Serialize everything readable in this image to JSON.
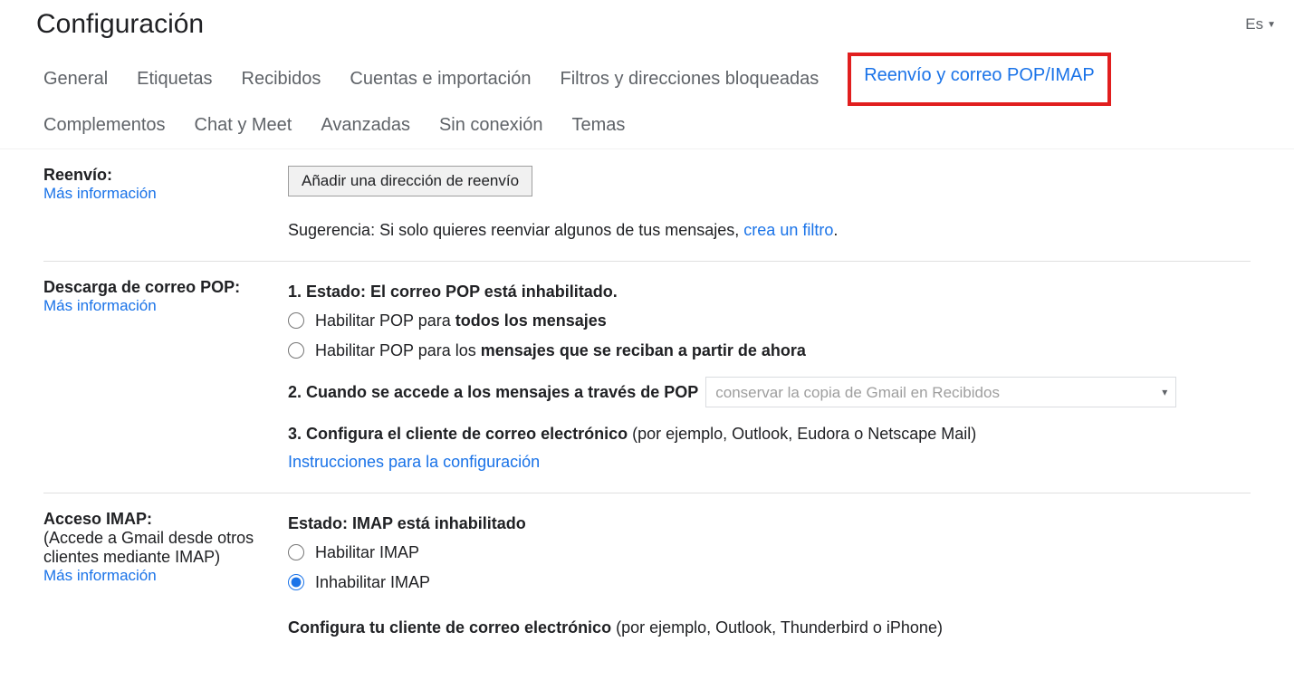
{
  "header": {
    "title": "Configuración",
    "language": "Es"
  },
  "tabs": {
    "general": "General",
    "labels": "Etiquetas",
    "inbox": "Recibidos",
    "accounts": "Cuentas e importación",
    "filters": "Filtros y direcciones bloqueadas",
    "forwarding": "Reenvío y correo POP/IMAP",
    "addons": "Complementos",
    "chat": "Chat y Meet",
    "advanced": "Avanzadas",
    "offline": "Sin conexión",
    "themes": "Temas"
  },
  "forwarding": {
    "label": "Reenvío:",
    "learn_more": "Más información",
    "add_button": "Añadir una dirección de reenvío",
    "tip_prefix": "Sugerencia: Si solo quieres reenviar algunos de tus mensajes, ",
    "tip_link": "crea un filtro",
    "tip_suffix": "."
  },
  "pop": {
    "label": "Descarga de correo POP:",
    "learn_more": "Más información",
    "status_prefix": "1. Estado: ",
    "status_value": "El correo POP está inhabilitado.",
    "opt1_prefix": "Habilitar POP para ",
    "opt1_bold": "todos los mensajes",
    "opt2_prefix": "Habilitar POP para los ",
    "opt2_bold": "mensajes que se reciban a partir de ahora",
    "step2": "2. Cuando se accede a los mensajes a través de POP",
    "select_value": "conservar la copia de Gmail en Recibidos",
    "step3_bold": "3. Configura el cliente de correo electrónico",
    "step3_rest": " (por ejemplo, Outlook, Eudora o Netscape Mail)",
    "instructions_link": "Instrucciones para la configuración"
  },
  "imap": {
    "label": "Acceso IMAP:",
    "note": "(Accede a Gmail desde otros clientes mediante IMAP)",
    "learn_more": "Más información",
    "status_prefix": "Estado: ",
    "status_value": "IMAP está inhabilitado",
    "opt_enable": "Habilitar IMAP",
    "opt_disable": "Inhabilitar IMAP",
    "configure_bold": "Configura tu cliente de correo electrónico",
    "configure_rest": " (por ejemplo, Outlook, Thunderbird o iPhone)"
  }
}
